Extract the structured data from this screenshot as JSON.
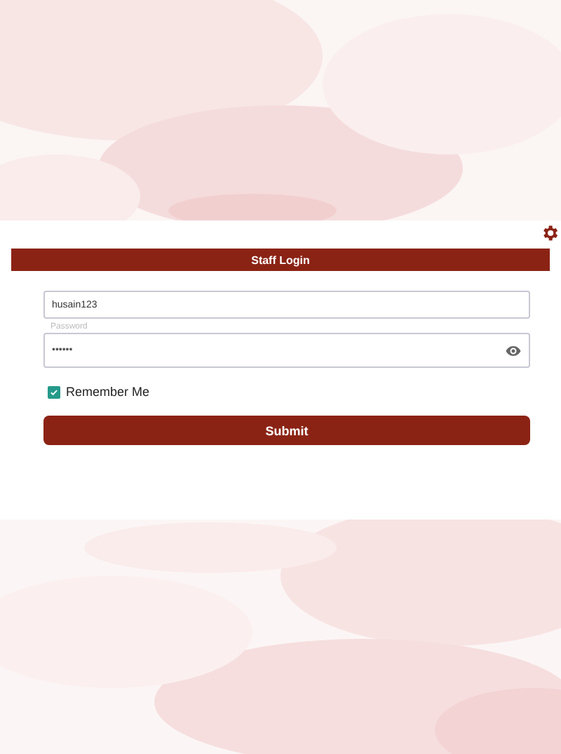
{
  "header": {
    "title": "Staff Login"
  },
  "username": {
    "value": "husain123"
  },
  "password": {
    "label": "Password",
    "value": "••••••"
  },
  "remember": {
    "label": "Remember Me",
    "checked": true
  },
  "submit": {
    "label": "Submit"
  }
}
